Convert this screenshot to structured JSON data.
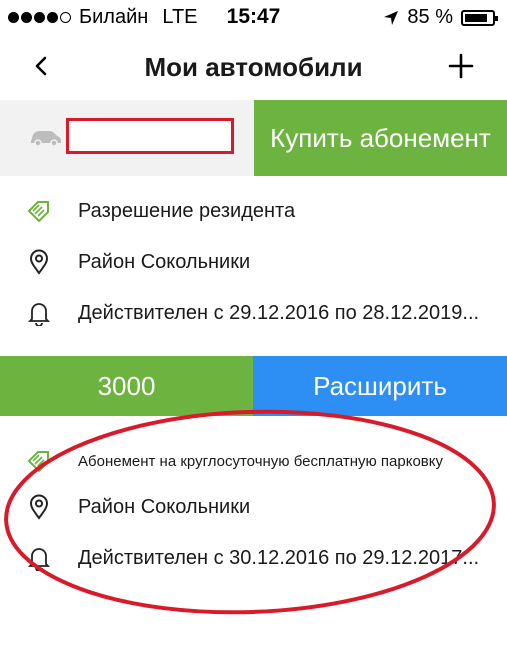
{
  "status_bar": {
    "carrier": "Билайн",
    "network": "LTE",
    "time": "15:47",
    "battery": "85 %",
    "battery_level": 0.85,
    "signal_bars": 4
  },
  "nav": {
    "title": "Мои автомобили",
    "back_icon": "chevron-left-icon",
    "add_icon": "plus-icon"
  },
  "car": {
    "icon": "car-icon",
    "buy_label": "Купить абонемент"
  },
  "permit_resident": {
    "type_label": "Разрешение резидента",
    "district": "Район Сокольники",
    "validity": "Действителен с 29.12.2016 по 28.12.2019..."
  },
  "actions": {
    "price_label": "3000",
    "extend_label": "Расширить"
  },
  "permit_subscription": {
    "type_label": "Абонемент на круглосуточную бесплатную парковку",
    "district": "Район Сокольники",
    "validity": "Действителен с 30.12.2016 по 29.12.2017..."
  },
  "colors": {
    "green": "#6db33f",
    "blue": "#2d8ff3",
    "highlight_red": "#d81b2b"
  }
}
